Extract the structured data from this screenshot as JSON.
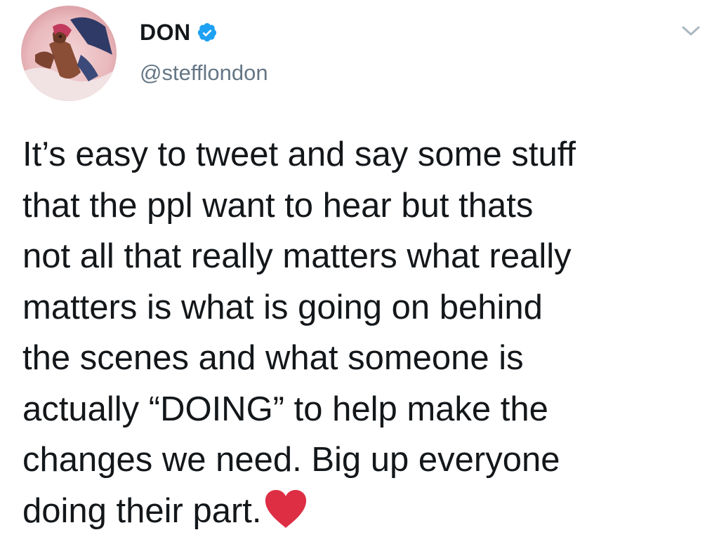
{
  "author": {
    "display_name": "DON",
    "handle": "@stefflondon",
    "verified_icon": "verified-badge-icon",
    "avatar": "profile-photo",
    "accent_color": "#1da1f2"
  },
  "menu": {
    "icon": "chevron-down-icon"
  },
  "tweet": {
    "lines": [
      "It’s easy to tweet and say some stuff",
      "that the ppl want to hear but thats",
      "not all that really matters what really",
      "matters is what is going on behind",
      "the scenes and what someone is",
      "actually “DOING” to help make the",
      "changes we need. Big up everyone",
      "doing their part."
    ],
    "emoji": "red-heart-icon",
    "emoji_color": "#dd2e44"
  }
}
